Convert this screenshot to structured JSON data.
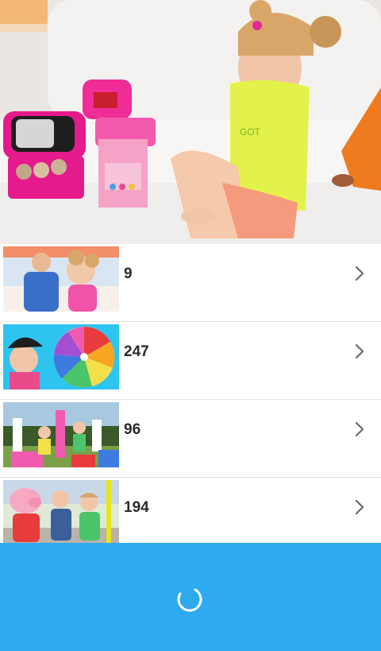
{
  "hero": {
    "icon": "featured-video-thumbnail"
  },
  "videos": [
    {
      "count": "9",
      "icon": "chevron-right-icon"
    },
    {
      "count": "247",
      "icon": "chevron-right-icon"
    },
    {
      "count": "96",
      "icon": "chevron-right-icon"
    },
    {
      "count": "194",
      "icon": "chevron-right-icon"
    }
  ],
  "footer": {
    "color": "#2eaaf0",
    "icon": "loading-spinner-icon"
  }
}
